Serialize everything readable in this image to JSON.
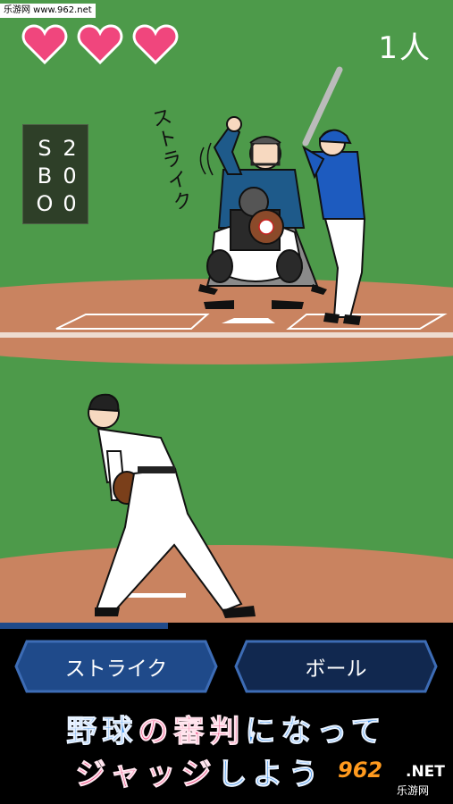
{
  "watermark_top": "乐游网 www.962.net",
  "hearts": [
    "heart-full",
    "heart-full",
    "heart-full"
  ],
  "hearts_color": "#f0467d",
  "count": "1人",
  "sbo": [
    {
      "label": "S",
      "value": "2"
    },
    {
      "label": "B",
      "value": "0"
    },
    {
      "label": "O",
      "value": "0"
    }
  ],
  "call_text": "ストライク",
  "pitch_progress": 0.37,
  "buttons": {
    "strike": "ストライク",
    "ball": "ボール"
  },
  "button_color": "#1f4a8a",
  "promo": {
    "line1": [
      {
        "text": "野球",
        "color": "blue"
      },
      {
        "text": "の",
        "color": "pink"
      },
      {
        "text": "審判",
        "color": "pink"
      },
      {
        "text": "になって",
        "color": "blue"
      }
    ],
    "line2": [
      {
        "text": "ジャッジ",
        "color": "pink"
      },
      {
        "text": "しよう",
        "color": "blue"
      }
    ]
  },
  "watermark_logo": {
    "brand": "962",
    "tld": ".NET",
    "site": "乐游网"
  },
  "colors": {
    "grass": "#4d9a4a",
    "dirt": "#c98360",
    "scoreboard": "#2e3f28",
    "background": "#000000"
  }
}
